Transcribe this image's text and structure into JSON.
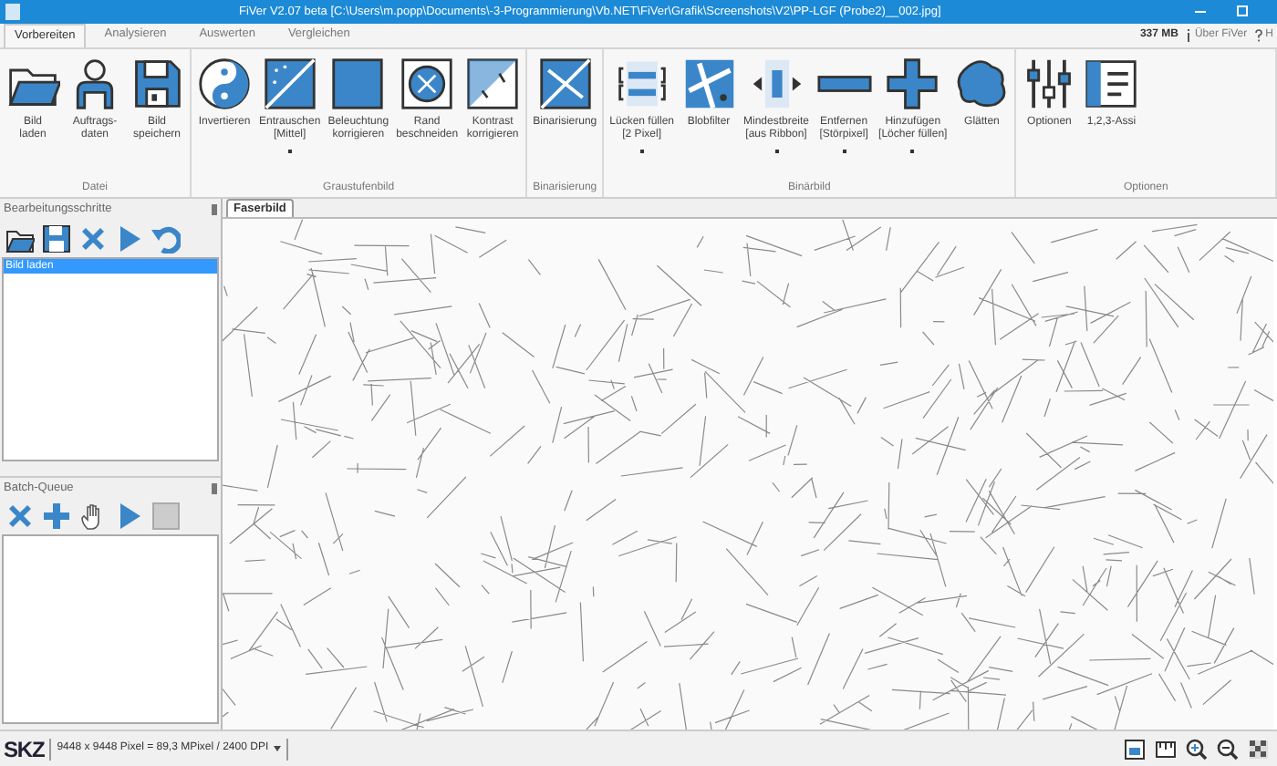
{
  "window": {
    "title": "FiVer V2.07 beta  [C:\\Users\\m.popp\\Documents\\-3-Programmierung\\Vb.NET\\FiVer\\Grafik\\Screenshots\\V2\\PP-LGF (Probe2)__002.jpg]"
  },
  "tabs": [
    {
      "label": "Vorbereiten",
      "selected": true
    },
    {
      "label": "Analysieren",
      "selected": false
    },
    {
      "label": "Auswerten",
      "selected": false
    },
    {
      "label": "Vergleichen",
      "selected": false
    }
  ],
  "header_right": {
    "memory": "337 MB",
    "about": "Über FiVer",
    "help": "H"
  },
  "ribbon_groups": [
    {
      "label": "Datei",
      "buttons": [
        {
          "label": "Bild\nladen",
          "dropdown": false
        },
        {
          "label": "Auftrags-\ndaten",
          "dropdown": false
        },
        {
          "label": "Bild\nspeichern",
          "dropdown": false
        }
      ]
    },
    {
      "label": "Graustufenbild",
      "buttons": [
        {
          "label": "Invertieren",
          "dropdown": false
        },
        {
          "label": "Entrauschen\n[Mittel]",
          "dropdown": true
        },
        {
          "label": "Beleuchtung\nkorrigieren",
          "dropdown": false
        },
        {
          "label": "Rand\nbeschneiden",
          "dropdown": false
        },
        {
          "label": "Kontrast\nkorrigieren",
          "dropdown": false
        }
      ]
    },
    {
      "label": "Binarisierung",
      "buttons": [
        {
          "label": "Binarisierung",
          "dropdown": false
        }
      ]
    },
    {
      "label": "Binärbild",
      "buttons": [
        {
          "label": "Lücken füllen\n[2 Pixel]",
          "dropdown": true
        },
        {
          "label": "Blobfilter",
          "dropdown": false
        },
        {
          "label": "Mindestbreite\n[aus Ribbon]",
          "dropdown": true
        },
        {
          "label": "Entfernen\n[Störpixel]",
          "dropdown": true
        },
        {
          "label": "Hinzufügen\n[Löcher füllen]",
          "dropdown": true
        },
        {
          "label": "Glätten",
          "dropdown": false
        }
      ]
    },
    {
      "label": "Optionen",
      "buttons": [
        {
          "label": "Optionen",
          "dropdown": false
        },
        {
          "label": "1,2,3-Assi",
          "dropdown": false
        }
      ]
    }
  ],
  "steps_panel": {
    "title": "Bearbeitungsschritte",
    "items": [
      {
        "label": "Bild laden",
        "selected": true
      }
    ]
  },
  "batch_panel": {
    "title": "Batch-Queue"
  },
  "document_tab": {
    "label": "Faserbild"
  },
  "status_bar": {
    "logo": "SKZ",
    "info": "9448 x 9448 Pixel = 89,3 MPixel / 2400 DPI"
  }
}
